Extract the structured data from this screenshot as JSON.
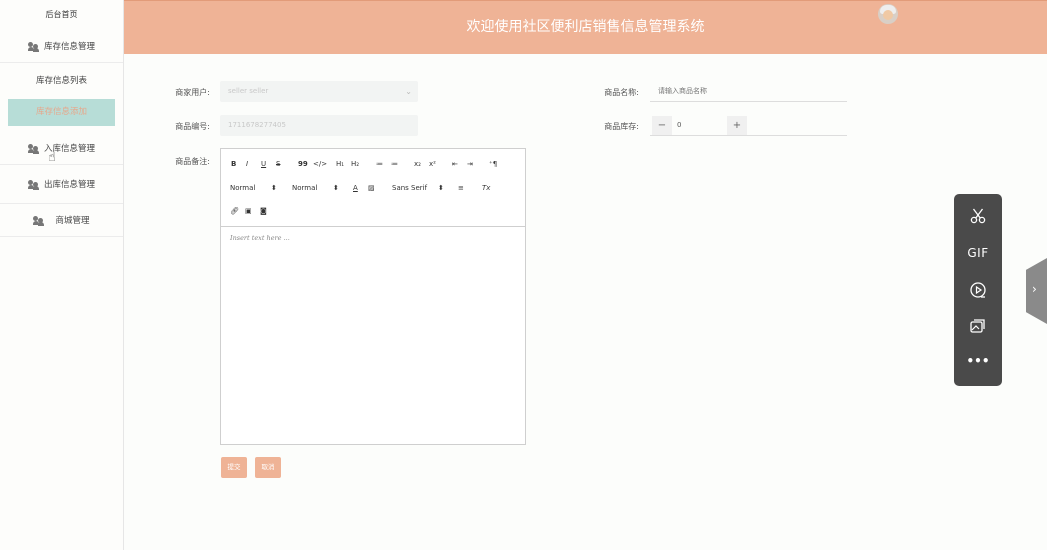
{
  "sidebar": {
    "home": "后台首页",
    "items": [
      {
        "label": "库存信息管理",
        "icon": "users-icon"
      },
      {
        "label": "入库信息管理",
        "icon": "users-icon"
      },
      {
        "label": "出库信息管理",
        "icon": "users-icon"
      },
      {
        "label": "商城管理",
        "icon": "users-icon"
      }
    ],
    "sub_items": [
      {
        "label": "库存信息列表",
        "active": false
      },
      {
        "label": "库存信息添加",
        "active": true
      }
    ]
  },
  "header": {
    "title": "欢迎使用社区便利店销售信息管理系统",
    "avatar": "user-avatar"
  },
  "form": {
    "merchant_label": "商家用户:",
    "merchant_value": "seller seller",
    "product_no_label": "商品编号:",
    "product_no_value": "1711678277405",
    "product_name_label": "商品名称:",
    "product_name_placeholder": "请输入商品名称",
    "stock_label": "商品库存:",
    "stock_value": "0",
    "remark_label": "商品备注:",
    "editor_placeholder": "Insert text here ...",
    "toolbar": {
      "bold": "B",
      "italic": "I",
      "underline": "U",
      "strike": "S",
      "quote": "99",
      "code": "</>",
      "h1": "H₁",
      "h2": "H₂",
      "ol": "≔",
      "ul": "≔",
      "sub": "x₂",
      "sup": "x²",
      "outdent": "⇤",
      "indent": "⇥",
      "rtl": "⁺¶",
      "size1": "Normal",
      "size2": "Normal",
      "font": "Sans Serif",
      "color": "A",
      "bg": "▨",
      "align": "≡",
      "clean": "Tx"
    },
    "submit": "提交",
    "cancel": "取消"
  },
  "float_panel": {
    "tools": [
      "scissors-icon",
      "GIF",
      "record-icon",
      "gallery-icon",
      "more-icon"
    ],
    "gif_label": "GIF",
    "more_label": "•••"
  },
  "colors": {
    "header": "#efb396",
    "active_sub_bg": "#b7ddd7",
    "button": "#efb396",
    "panel": "#4a4a4a"
  }
}
